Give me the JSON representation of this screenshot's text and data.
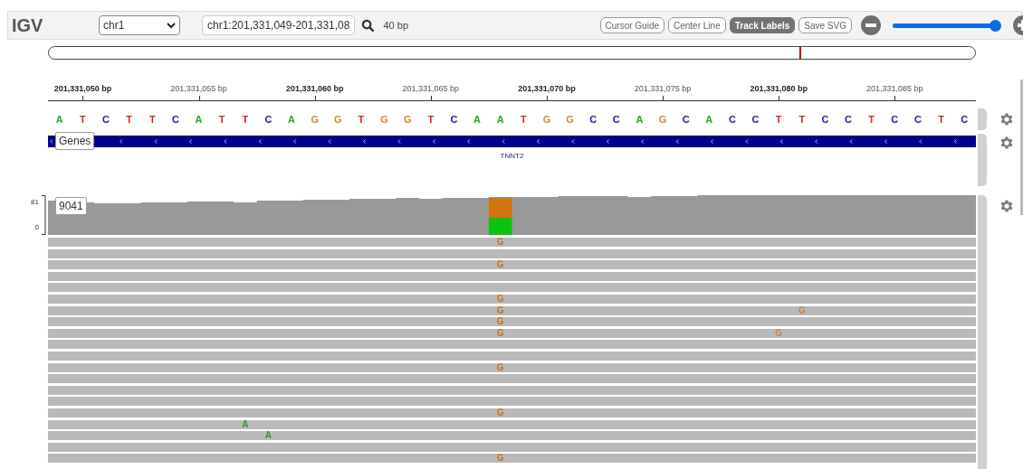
{
  "toolbar": {
    "logo": "IGV",
    "chromosome": "chr1",
    "locus": "chr1:201,331,049-201,331,08",
    "width": "40 bp",
    "buttons": [
      {
        "label": "Cursor Guide",
        "selected": false
      },
      {
        "label": "Center Line",
        "selected": false
      },
      {
        "label": "Track Labels",
        "selected": true
      },
      {
        "label": "Save SVG",
        "selected": false
      }
    ],
    "zoom": {
      "level": 1
    }
  },
  "ideogram": {
    "level": 0.81
  },
  "ruler": {
    "ticks": [
      {
        "label": "201,331,050 bp",
        "major": true
      },
      {
        "label": "201,331,055 bp",
        "major": false
      },
      {
        "label": "201,331,060 bp",
        "major": true
      },
      {
        "label": "201,331,065 bp",
        "major": false
      },
      {
        "label": "201,331,070 bp",
        "major": true
      },
      {
        "label": "201,331,075 bp",
        "major": false
      },
      {
        "label": "201,331,080 bp",
        "major": true
      },
      {
        "label": "201,331,085 bp",
        "major": false
      }
    ]
  },
  "sequence": [
    {
      "base": "A",
      "color": "#22aa22"
    },
    {
      "base": "T",
      "color": "#dd2222"
    },
    {
      "base": "C",
      "color": "#2222aa"
    },
    {
      "base": "T",
      "color": "#dd2222"
    },
    {
      "base": "T",
      "color": "#dd2222"
    },
    {
      "base": "C",
      "color": "#2222aa"
    },
    {
      "base": "A",
      "color": "#22aa22"
    },
    {
      "base": "T",
      "color": "#dd2222"
    },
    {
      "base": "T",
      "color": "#dd2222"
    },
    {
      "base": "C",
      "color": "#2222aa"
    },
    {
      "base": "A",
      "color": "#22aa22"
    },
    {
      "base": "G",
      "color": "#d08a2a"
    },
    {
      "base": "G",
      "color": "#d08a2a"
    },
    {
      "base": "T",
      "color": "#dd2222"
    },
    {
      "base": "G",
      "color": "#d08a2a"
    },
    {
      "base": "G",
      "color": "#d08a2a"
    },
    {
      "base": "T",
      "color": "#dd2222"
    },
    {
      "base": "C",
      "color": "#2222aa"
    },
    {
      "base": "A",
      "color": "#22aa22"
    },
    {
      "base": "A",
      "color": "#22aa22"
    },
    {
      "base": "T",
      "color": "#dd2222"
    },
    {
      "base": "G",
      "color": "#d08a2a"
    },
    {
      "base": "G",
      "color": "#d08a2a"
    },
    {
      "base": "C",
      "color": "#2222aa"
    },
    {
      "base": "C",
      "color": "#2222aa"
    },
    {
      "base": "A",
      "color": "#22aa22"
    },
    {
      "base": "G",
      "color": "#d08a2a"
    },
    {
      "base": "C",
      "color": "#2222aa"
    },
    {
      "base": "A",
      "color": "#22aa22"
    },
    {
      "base": "C",
      "color": "#2222aa"
    },
    {
      "base": "C",
      "color": "#2222aa"
    },
    {
      "base": "T",
      "color": "#dd2222"
    },
    {
      "base": "T",
      "color": "#dd2222"
    },
    {
      "base": "C",
      "color": "#2222aa"
    },
    {
      "base": "C",
      "color": "#2222aa"
    },
    {
      "base": "T",
      "color": "#dd2222"
    },
    {
      "base": "C",
      "color": "#2222aa"
    },
    {
      "base": "C",
      "color": "#2222aa"
    },
    {
      "base": "T",
      "color": "#dd2222"
    },
    {
      "base": "C",
      "color": "#2222aa"
    }
  ],
  "genes": {
    "track_label": "Genes",
    "gene": "TNNT2"
  },
  "coverage": {
    "track_label": "9041",
    "scale_max": "81",
    "scale_min": "0"
  },
  "read_mismatches": [
    {
      "base": "G",
      "color": "#c87020"
    },
    {
      "base": "G",
      "color": "#c87020"
    },
    {
      "base": "G",
      "color": "#c87020"
    },
    {
      "base": "G",
      "color": "#c87020"
    },
    {
      "base": "G",
      "color": "#cc8040"
    },
    {
      "base": "G",
      "color": "#c87020"
    },
    {
      "base": "G",
      "color": "#c87020"
    },
    {
      "base": "G",
      "color": "#cc8040"
    },
    {
      "base": "G",
      "color": "#c87020"
    },
    {
      "base": "G",
      "color": "#c87020"
    },
    {
      "base": "A",
      "color": "#2e9a2e"
    },
    {
      "base": "A",
      "color": "#2e9a2e"
    },
    {
      "base": "G",
      "color": "#c87020"
    }
  ]
}
